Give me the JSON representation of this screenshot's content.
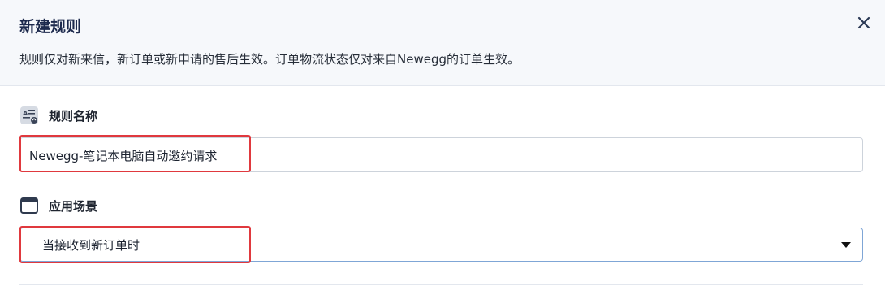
{
  "dialog": {
    "title": "新建规则",
    "subtitle": "规则仅对新来信，新订单或新申请的售后生效。订单物流状态仅对来自Newegg的订单生效。",
    "close_icon": "close-icon"
  },
  "rule_name": {
    "label": "规则名称",
    "icon": "rule-name-icon",
    "value": "Newegg-笔记本电脑自动邀约请求"
  },
  "scenario": {
    "label": "应用场景",
    "icon": "window-icon",
    "selected": "当接收到新订单时"
  },
  "colors": {
    "highlight": "#e0393e",
    "title": "#1d2a4d",
    "header_bg": "#f6f8fb"
  }
}
